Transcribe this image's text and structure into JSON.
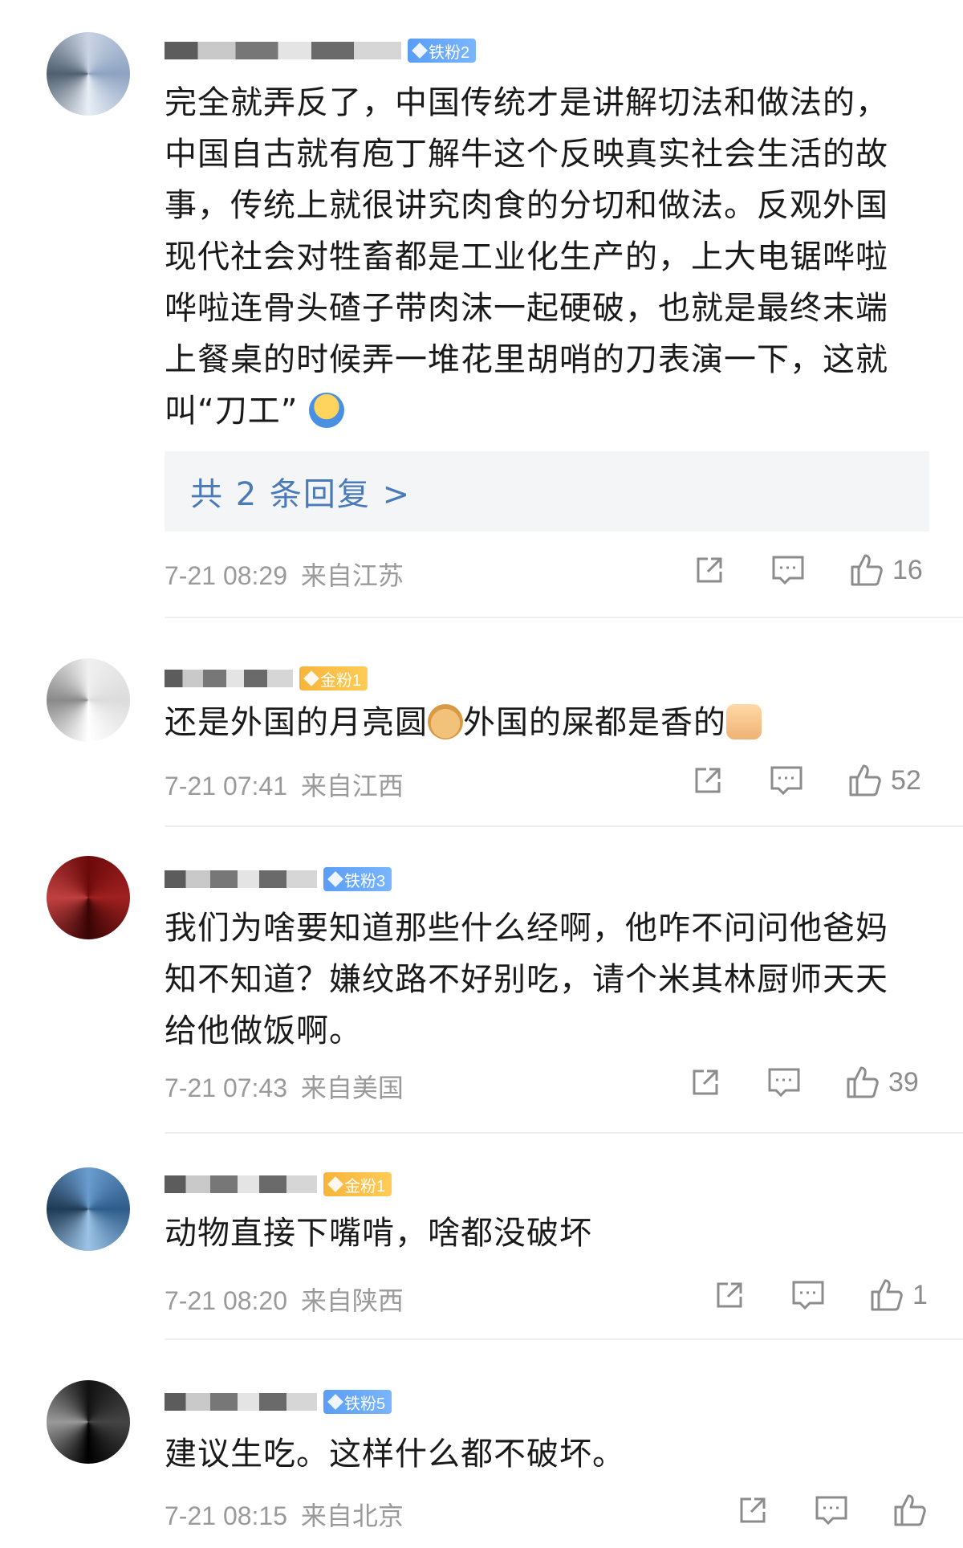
{
  "comments": [
    {
      "badge": "铁粉2",
      "text": "完全就弄反了，中国传统才是讲解切法和做法的，中国自古就有庖丁解牛这个反映真实社会生活的故事，传统上就很讲究肉食的分切和做法。反观外国现代社会对牲畜都是工业化生产的，上大电锯哗啦哗啦连骨头碴子带肉沫一起硬破，也就是最终末端上餐桌的时候弄一堆花里胡哨的刀表演一下，这就叫“刀工”",
      "replies_label": "共 2 条回复 >",
      "time": "7-21 08:29",
      "location": "来自江苏",
      "likes": "16"
    },
    {
      "badge": "金粉1",
      "text_part1": "还是外国的月亮圆",
      "text_part2": "外国的屎都是香的",
      "time": "7-21 07:41",
      "location": "来自江西",
      "likes": "52"
    },
    {
      "badge": "铁粉3",
      "text": "我们为啥要知道那些什么经啊，他咋不问问他爸妈知不知道？嫌纹路不好别吃，请个米其林厨师天天给他做饭啊。",
      "time": "7-21 07:43",
      "location": "来自美国",
      "likes": "39"
    },
    {
      "badge": "金粉1",
      "text": "动物直接下嘴啃，啥都没破坏",
      "time": "7-21 08:20",
      "location": "来自陕西",
      "likes": "1"
    },
    {
      "badge": "铁粉5",
      "text": "建议生吃。这样什么都不破坏。",
      "time": "7-21 08:15",
      "location": "来自北京",
      "likes": ""
    }
  ],
  "icons": {
    "share": "share-icon",
    "comment": "comment-icon",
    "like": "like-icon"
  },
  "colors": {
    "badge_blue": "#5a9df5",
    "badge_gold": "#f7b43b",
    "reply_link": "#4a7ab8",
    "meta_gray": "#9a9a9a"
  }
}
